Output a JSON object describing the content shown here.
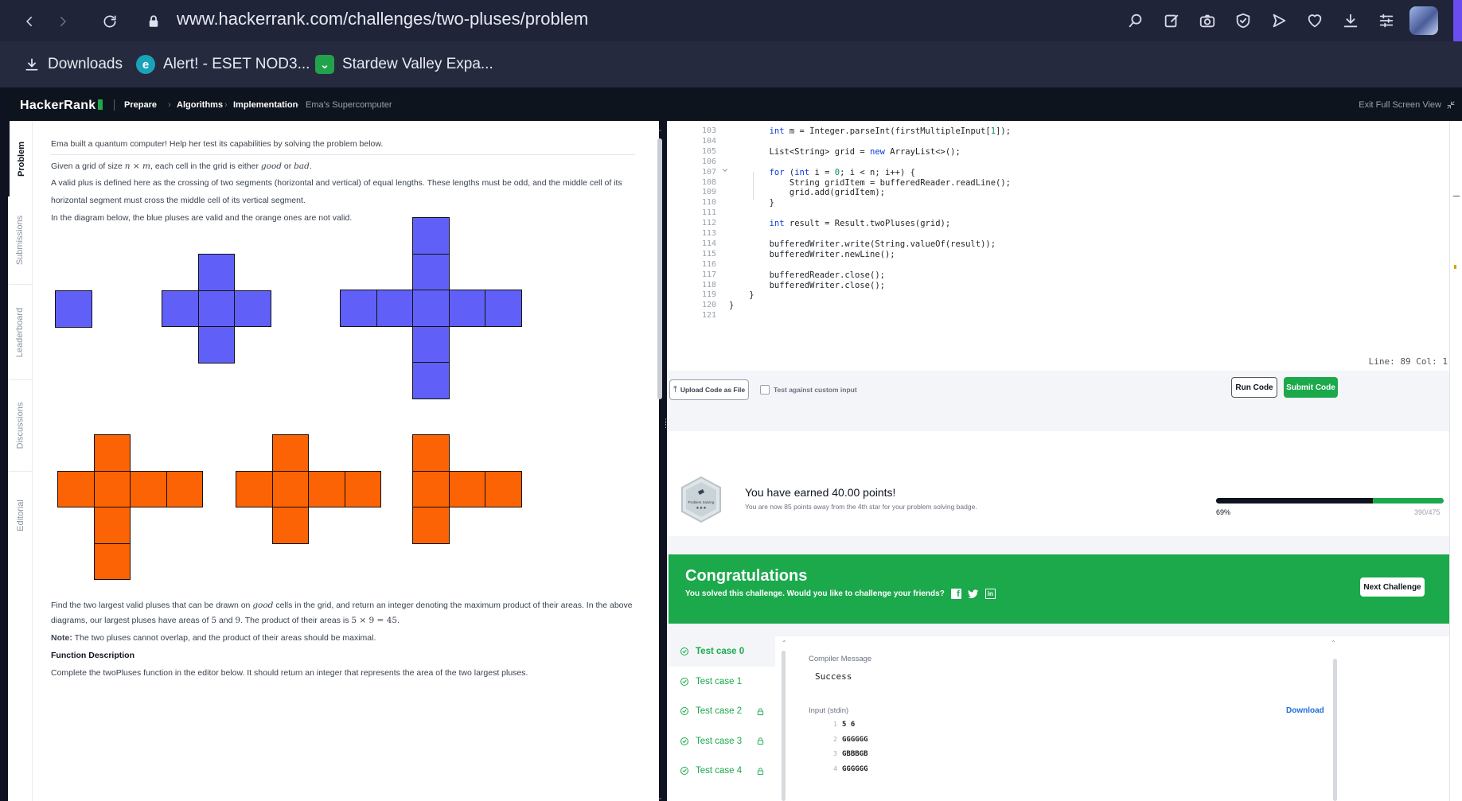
{
  "browser": {
    "url": "www.hackerrank.com/challenges/two-pluses/problem",
    "bookmarks": [
      {
        "label": "Downloads"
      },
      {
        "label": "Alert! - ESET NOD3..."
      },
      {
        "label": "Stardew Valley Expa..."
      }
    ]
  },
  "header": {
    "logo": "HackerRank",
    "breadcrumbs": [
      "Prepare",
      "Algorithms",
      "Implementation",
      "Ema's Supercomputer"
    ],
    "exit_fullscreen": "Exit Full Screen View"
  },
  "sidebar_tabs": [
    "Problem",
    "Submissions",
    "Leaderboard",
    "Discussions",
    "Editorial"
  ],
  "problem": {
    "intro": "Ema built a quantum computer! Help her test its capabilities by solving the problem below.",
    "grid_pre": "Given a grid of size ",
    "grid_math": "n × m",
    "grid_mid": ", each cell in the grid is either ",
    "good": "good",
    "or": " or ",
    "bad": "bad",
    "period": ".",
    "plus_def": "A valid plus is defined here as the crossing of two segments (horizontal and vertical) of equal lengths. These lengths must be odd, and the middle cell of its horizontal segment must cross the middle cell of its vertical segment.",
    "diagram_note": "In the diagram below, the blue pluses are valid and the orange ones are not valid.",
    "find_pre": "Find the two largest valid pluses that can be drawn on ",
    "find_post": " cells in the grid, and return an integer denoting the maximum product of their areas. In the above diagrams, our largest pluses have areas of ",
    "area_a": "5",
    "and": " and ",
    "area_b": "9",
    "prod_pre": ". The product of their areas is ",
    "product": "5 × 9 = 45",
    "note_label": "Note:",
    "note_text": " The two pluses cannot overlap, and the product of their areas should be maximal.",
    "func_desc": "Function Description",
    "func_text": "Complete the twoPluses function in the editor below. It should return an integer that represents the area of the two largest pluses."
  },
  "editor": {
    "lines": [
      {
        "n": "103",
        "code": "        int m = Integer.parseInt(firstMultipleInput[1]);"
      },
      {
        "n": "104",
        "code": ""
      },
      {
        "n": "105",
        "code": "        List<String> grid = new ArrayList<>();"
      },
      {
        "n": "106",
        "code": ""
      },
      {
        "n": "107",
        "code": "        for (int i = 0; i < n; i++) {"
      },
      {
        "n": "108",
        "code": "            String gridItem = bufferedReader.readLine();"
      },
      {
        "n": "109",
        "code": "            grid.add(gridItem);"
      },
      {
        "n": "110",
        "code": "        }"
      },
      {
        "n": "111",
        "code": ""
      },
      {
        "n": "112",
        "code": "        int result = Result.twoPluses(grid);"
      },
      {
        "n": "113",
        "code": ""
      },
      {
        "n": "114",
        "code": "        bufferedWriter.write(String.valueOf(result));"
      },
      {
        "n": "115",
        "code": "        bufferedWriter.newLine();"
      },
      {
        "n": "116",
        "code": ""
      },
      {
        "n": "117",
        "code": "        bufferedReader.close();"
      },
      {
        "n": "118",
        "code": "        bufferedWriter.close();"
      },
      {
        "n": "119",
        "code": "    }"
      },
      {
        "n": "120",
        "code": "}"
      },
      {
        "n": "121",
        "code": ""
      }
    ],
    "cursor_info": "Line: 89 Col: 1"
  },
  "actions": {
    "upload": "Upload Code as File",
    "custom_input": "Test against custom input",
    "run": "Run Code",
    "submit": "Submit Code"
  },
  "points": {
    "badge_label": "Problem Solving",
    "earned": "You have earned 40.00 points!",
    "sub": "You are now 85 points away from the 4th star for your problem solving badge.",
    "percent_label": "69%",
    "progress": 0.69,
    "score": "390/475"
  },
  "congrats": {
    "title": "Congratulations",
    "sub": "You solved this challenge. Would you like to challenge your friends?",
    "next": "Next Challenge"
  },
  "tests": {
    "cases": [
      "Test case 0",
      "Test case 1",
      "Test case 2",
      "Test case 3",
      "Test case 4"
    ],
    "compiler_label": "Compiler Message",
    "compiler_msg": "Success",
    "input_label": "Input (stdin)",
    "download": "Download",
    "input_lines": [
      {
        "n": "1",
        "text": "5 6"
      },
      {
        "n": "2",
        "text": "GGGGGG"
      },
      {
        "n": "3",
        "text": "GBBBGB"
      },
      {
        "n": "4",
        "text": "GGGGGG"
      }
    ]
  },
  "colors": {
    "accent": "#1ba94c",
    "valid_plus": "#6060f8",
    "invalid_plus": "#fc6304",
    "hr_dark": "#0e141e"
  }
}
